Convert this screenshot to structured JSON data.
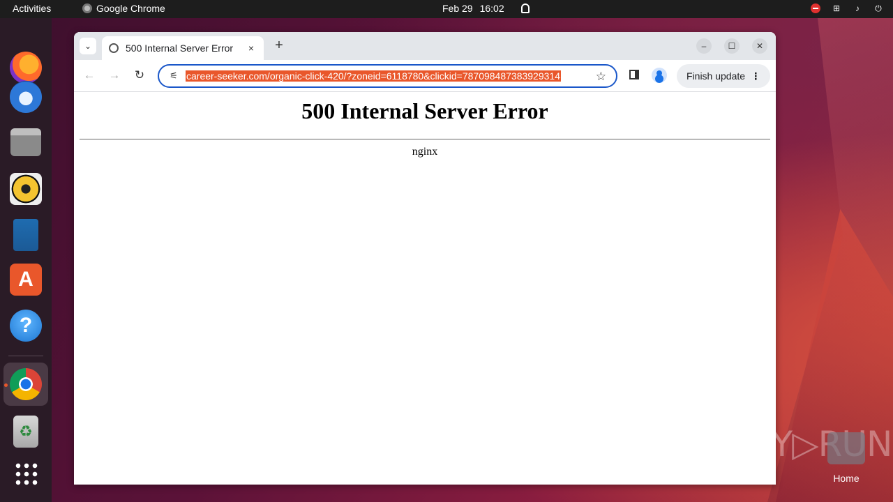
{
  "topbar": {
    "activities": "Activities",
    "app_name": "Google Chrome",
    "date": "Feb 29",
    "time": "16:02"
  },
  "dock": {
    "items": [
      "Firefox",
      "Thunderbird",
      "Files",
      "Rhythmbox",
      "LibreOffice Writer",
      "App Center",
      "Help",
      "Google Chrome",
      "Trash",
      "Show Applications"
    ]
  },
  "browser": {
    "tab": {
      "title": "500 Internal Server Error",
      "close": "×"
    },
    "new_tab": "+",
    "window_controls": {
      "minimize": "–",
      "maximize": "☐",
      "close": "✕"
    },
    "nav": {
      "back": "←",
      "forward": "→",
      "reload": "↻"
    },
    "omnibox": {
      "url": "career-seeker.com/organic-click-420/?zoneid=6118780&clickid=787098487383929314"
    },
    "finish_update": "Finish update",
    "menu": "⋮"
  },
  "page": {
    "heading": "500 Internal Server Error",
    "server": "nginx"
  },
  "desktop": {
    "watermark": "ANY▷RUN",
    "home_label": "Home"
  },
  "colors": {
    "url_highlight": "#e9572b",
    "omnibox_focus": "#1a57c9",
    "topbar": "#1d1d1d",
    "dock": "#2a1b26"
  }
}
